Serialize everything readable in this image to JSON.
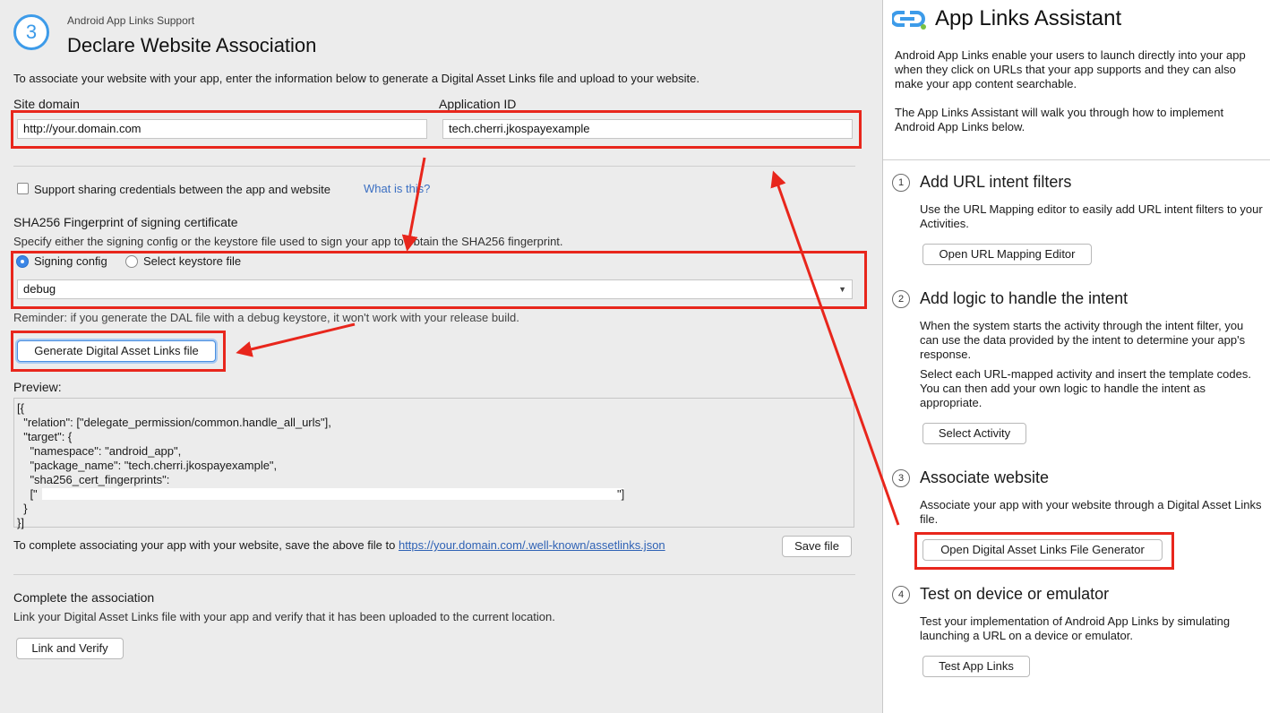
{
  "header": {
    "step_number": "3",
    "subtitle": "Android App Links Support",
    "title": "Declare Website Association"
  },
  "intro": "To associate your website with your app, enter the information below to generate a Digital Asset Links file and upload to your website.",
  "site_domain": {
    "label": "Site domain",
    "value": "http://your.domain.com"
  },
  "application_id": {
    "label": "Application ID",
    "value": "tech.cherri.jkospayexample"
  },
  "share_credentials": {
    "label": "Support sharing credentials between the app and website",
    "checked": false,
    "help_link": "What is this?"
  },
  "sha256": {
    "title": "SHA256 Fingerprint of signing certificate",
    "description": "Specify either the signing config or the keystore file used to sign your app to obtain the SHA256 fingerprint.",
    "option_signing": "Signing config",
    "option_keystore": "Select keystore file",
    "selected": "Signing config",
    "config_value": "debug",
    "reminder": "Reminder: if you generate the DAL file with a debug keystore, it won't work with your release build."
  },
  "generate_button": "Generate Digital Asset Links file",
  "preview": {
    "label": "Preview:",
    "lines": [
      "[{",
      "  \"relation\": [\"delegate_permission/common.handle_all_urls\"],",
      "  \"target\": {",
      "    \"namespace\": \"android_app\",",
      "    \"package_name\": \"tech.cherri.jkospayexample\",",
      "    \"sha256_cert_fingerprints\":",
      "    [\"",
      "  }",
      "}]"
    ],
    "fingerprint_close": "\"]"
  },
  "save": {
    "text": "To complete associating your app with your website, save the above file to ",
    "link": "https://your.domain.com/.well-known/assetlinks.json",
    "button": "Save file"
  },
  "complete": {
    "title": "Complete the association",
    "description": "Link your Digital Asset Links file with your app and verify that it has been uploaded to the current location.",
    "button": "Link and Verify"
  },
  "assistant": {
    "title": "App Links Assistant",
    "intro1": "Android App Links enable your users to launch directly into your app when they click on URLs that your app supports and they can also make your app content searchable.",
    "intro2": "The App Links Assistant will walk you through how to implement Android App Links below.",
    "steps": [
      {
        "num": "1",
        "title": "Add URL intent filters",
        "desc": "Use the URL Mapping editor to easily add URL intent filters to your Activities.",
        "button": "Open URL Mapping Editor"
      },
      {
        "num": "2",
        "title": "Add logic to handle the intent",
        "desc": "When the system starts the activity through the intent filter, you can use the data provided by the intent to determine your app's response.",
        "desc2": "Select each URL-mapped activity and insert the template codes. You can then add your own logic to handle the intent as appropriate.",
        "button": "Select Activity"
      },
      {
        "num": "3",
        "title": "Associate website",
        "desc": "Associate your app with your website through a Digital Asset Links file.",
        "button": "Open Digital Asset Links File Generator"
      },
      {
        "num": "4",
        "title": "Test on device or emulator",
        "desc": "Test your implementation of Android App Links by simulating launching a URL on a device or emulator.",
        "button": "Test App Links"
      }
    ]
  },
  "colors": {
    "accent": "#3d9be9",
    "annotation_red": "#e8261c",
    "link": "#2f62b5",
    "help_link": "#3b6fc2"
  }
}
